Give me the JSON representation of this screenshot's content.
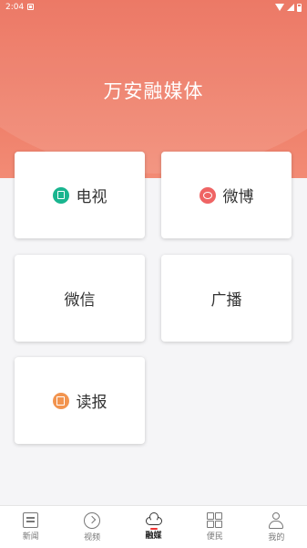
{
  "status_bar": {
    "time": "2:04"
  },
  "app_title": "万安融媒体",
  "tiles": [
    {
      "label": "电视",
      "icon": "tv-icon",
      "icon_color": "#19b58f"
    },
    {
      "label": "微博",
      "icon": "weibo-icon",
      "icon_color": "#ef6464"
    },
    {
      "label": "微信"
    },
    {
      "label": "广播"
    },
    {
      "label": "读报",
      "icon": "newspaper-icon",
      "icon_color": "#f2944f"
    }
  ],
  "tabs": [
    {
      "label": "新闻",
      "icon": "news-icon"
    },
    {
      "label": "视频",
      "icon": "video-icon"
    },
    {
      "label": "融媒",
      "icon": "cloud-icon",
      "active": true
    },
    {
      "label": "便民",
      "icon": "grid-icon"
    },
    {
      "label": "我的",
      "icon": "user-icon"
    }
  ],
  "colors": {
    "header_top": "#ea6a55",
    "header_bottom": "#f28b75",
    "active_accent": "#e33333"
  }
}
